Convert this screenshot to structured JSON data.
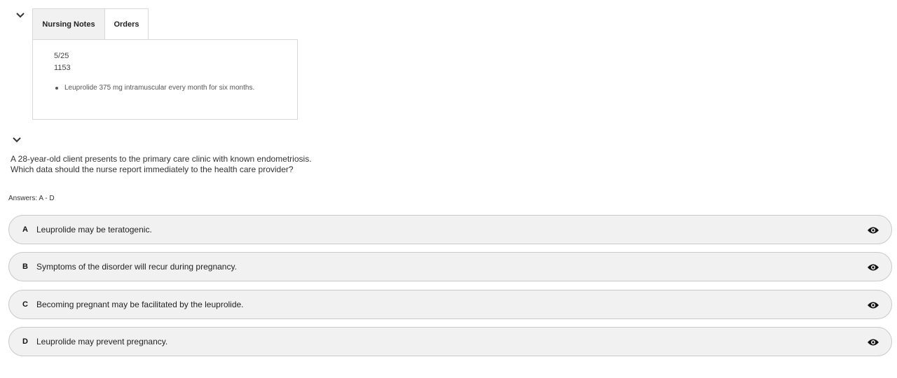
{
  "tabs": [
    {
      "label": "Nursing Notes",
      "active": true
    },
    {
      "label": "Orders",
      "active": false
    }
  ],
  "notes": {
    "date": "5/25",
    "time": "1153",
    "items": [
      "Leuprolide 375 mg intramuscular every month for six months."
    ]
  },
  "question": {
    "line1": "A 28-year-old client presents to the primary care clinic with known endometriosis.",
    "line2": "Which data should the nurse report immediately to the health care provider?"
  },
  "answers_label": "Answers: A - D",
  "options": [
    {
      "letter": "A",
      "text": "Leuprolide may be teratogenic.",
      "icon": "eye-icon"
    },
    {
      "letter": "B",
      "text": "Symptoms of the disorder will recur during pregnancy.",
      "icon": "eye-icon"
    },
    {
      "letter": "C",
      "text": "Becoming pregnant may be facilitated by the leuprolide.",
      "icon": "eye-icon"
    },
    {
      "letter": "D",
      "text": "Leuprolide may prevent pregnancy.",
      "icon": "eye-icon"
    }
  ],
  "colors": {
    "option_bg": "#f1f1f1",
    "border": "#c9c9c9",
    "active_tab_bg": "#f1f1f1"
  }
}
